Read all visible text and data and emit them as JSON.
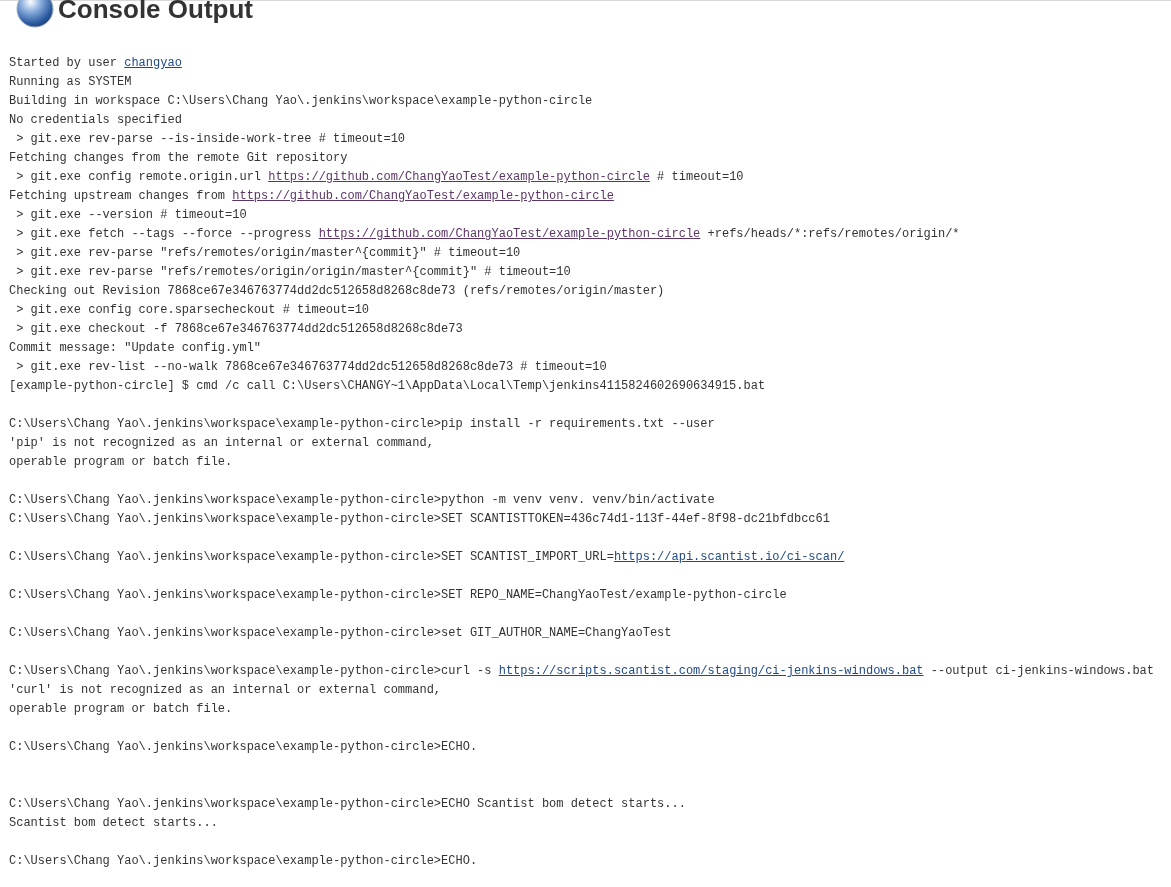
{
  "header": {
    "title": "Console Output"
  },
  "lines": [
    {
      "kind": "text",
      "segments": [
        {
          "kind": "text",
          "text": "Started by user "
        },
        {
          "kind": "link",
          "text": "changyao",
          "visited": false
        }
      ]
    },
    {
      "kind": "text",
      "segments": [
        {
          "kind": "text",
          "text": "Running as SYSTEM"
        }
      ]
    },
    {
      "kind": "text",
      "segments": [
        {
          "kind": "text",
          "text": "Building in workspace C:\\Users\\Chang Yao\\.jenkins\\workspace\\example-python-circle"
        }
      ]
    },
    {
      "kind": "text",
      "segments": [
        {
          "kind": "text",
          "text": "No credentials specified"
        }
      ]
    },
    {
      "kind": "text",
      "segments": [
        {
          "kind": "text",
          "text": " > git.exe rev-parse --is-inside-work-tree # timeout=10"
        }
      ]
    },
    {
      "kind": "text",
      "segments": [
        {
          "kind": "text",
          "text": "Fetching changes from the remote Git repository"
        }
      ]
    },
    {
      "kind": "text",
      "segments": [
        {
          "kind": "text",
          "text": " > git.exe config remote.origin.url "
        },
        {
          "kind": "link",
          "text": "https://github.com/ChangYaoTest/example-python-circle",
          "visited": true
        },
        {
          "kind": "text",
          "text": " # timeout=10"
        }
      ]
    },
    {
      "kind": "text",
      "segments": [
        {
          "kind": "text",
          "text": "Fetching upstream changes from "
        },
        {
          "kind": "link",
          "text": "https://github.com/ChangYaoTest/example-python-circle",
          "visited": true
        }
      ]
    },
    {
      "kind": "text",
      "segments": [
        {
          "kind": "text",
          "text": " > git.exe --version # timeout=10"
        }
      ]
    },
    {
      "kind": "text",
      "segments": [
        {
          "kind": "text",
          "text": " > git.exe fetch --tags --force --progress "
        },
        {
          "kind": "link",
          "text": "https://github.com/ChangYaoTest/example-python-circle",
          "visited": true
        },
        {
          "kind": "text",
          "text": " +refs/heads/*:refs/remotes/origin/*"
        }
      ]
    },
    {
      "kind": "text",
      "segments": [
        {
          "kind": "text",
          "text": " > git.exe rev-parse \"refs/remotes/origin/master^{commit}\" # timeout=10"
        }
      ]
    },
    {
      "kind": "text",
      "segments": [
        {
          "kind": "text",
          "text": " > git.exe rev-parse \"refs/remotes/origin/origin/master^{commit}\" # timeout=10"
        }
      ]
    },
    {
      "kind": "text",
      "segments": [
        {
          "kind": "text",
          "text": "Checking out Revision 7868ce67e346763774dd2dc512658d8268c8de73 (refs/remotes/origin/master)"
        }
      ]
    },
    {
      "kind": "text",
      "segments": [
        {
          "kind": "text",
          "text": " > git.exe config core.sparsecheckout # timeout=10"
        }
      ]
    },
    {
      "kind": "text",
      "segments": [
        {
          "kind": "text",
          "text": " > git.exe checkout -f 7868ce67e346763774dd2dc512658d8268c8de73"
        }
      ]
    },
    {
      "kind": "text",
      "segments": [
        {
          "kind": "text",
          "text": "Commit message: \"Update config.yml\""
        }
      ]
    },
    {
      "kind": "text",
      "segments": [
        {
          "kind": "text",
          "text": " > git.exe rev-list --no-walk 7868ce67e346763774dd2dc512658d8268c8de73 # timeout=10"
        }
      ]
    },
    {
      "kind": "text",
      "segments": [
        {
          "kind": "text",
          "text": "[example-python-circle] $ cmd /c call C:\\Users\\CHANGY~1\\AppData\\Local\\Temp\\jenkins4115824602690634915.bat"
        }
      ]
    },
    {
      "kind": "blank"
    },
    {
      "kind": "text",
      "segments": [
        {
          "kind": "text",
          "text": "C:\\Users\\Chang Yao\\.jenkins\\workspace\\example-python-circle>pip install -r requirements.txt --user"
        }
      ]
    },
    {
      "kind": "text",
      "segments": [
        {
          "kind": "text",
          "text": "'pip' is not recognized as an internal or external command,"
        }
      ]
    },
    {
      "kind": "text",
      "segments": [
        {
          "kind": "text",
          "text": "operable program or batch file."
        }
      ]
    },
    {
      "kind": "blank"
    },
    {
      "kind": "text",
      "segments": [
        {
          "kind": "text",
          "text": "C:\\Users\\Chang Yao\\.jenkins\\workspace\\example-python-circle>python -m venv venv. venv/bin/activate"
        }
      ]
    },
    {
      "kind": "text",
      "segments": [
        {
          "kind": "text",
          "text": "C:\\Users\\Chang Yao\\.jenkins\\workspace\\example-python-circle>SET SCANTISTTOKEN=436c74d1-113f-44ef-8f98-dc21bfdbcc61"
        }
      ]
    },
    {
      "kind": "blank"
    },
    {
      "kind": "text",
      "segments": [
        {
          "kind": "text",
          "text": "C:\\Users\\Chang Yao\\.jenkins\\workspace\\example-python-circle>SET SCANTIST_IMPORT_URL="
        },
        {
          "kind": "link",
          "text": "https://api.scantist.io/ci-scan/",
          "visited": false
        }
      ]
    },
    {
      "kind": "blank"
    },
    {
      "kind": "text",
      "segments": [
        {
          "kind": "text",
          "text": "C:\\Users\\Chang Yao\\.jenkins\\workspace\\example-python-circle>SET REPO_NAME=ChangYaoTest/example-python-circle"
        }
      ]
    },
    {
      "kind": "blank"
    },
    {
      "kind": "text",
      "segments": [
        {
          "kind": "text",
          "text": "C:\\Users\\Chang Yao\\.jenkins\\workspace\\example-python-circle>set GIT_AUTHOR_NAME=ChangYaoTest"
        }
      ]
    },
    {
      "kind": "blank"
    },
    {
      "kind": "text",
      "segments": [
        {
          "kind": "text",
          "text": "C:\\Users\\Chang Yao\\.jenkins\\workspace\\example-python-circle>curl -s "
        },
        {
          "kind": "link",
          "text": "https://scripts.scantist.com/staging/ci-jenkins-windows.bat",
          "visited": false
        },
        {
          "kind": "text",
          "text": " --output ci-jenkins-windows.bat"
        }
      ]
    },
    {
      "kind": "text",
      "segments": [
        {
          "kind": "text",
          "text": "'curl' is not recognized as an internal or external command,"
        }
      ]
    },
    {
      "kind": "text",
      "segments": [
        {
          "kind": "text",
          "text": "operable program or batch file."
        }
      ]
    },
    {
      "kind": "blank"
    },
    {
      "kind": "text",
      "segments": [
        {
          "kind": "text",
          "text": "C:\\Users\\Chang Yao\\.jenkins\\workspace\\example-python-circle>ECHO."
        }
      ]
    },
    {
      "kind": "blank"
    },
    {
      "kind": "blank"
    },
    {
      "kind": "text",
      "segments": [
        {
          "kind": "text",
          "text": "C:\\Users\\Chang Yao\\.jenkins\\workspace\\example-python-circle>ECHO Scantist bom detect starts..."
        }
      ]
    },
    {
      "kind": "text",
      "segments": [
        {
          "kind": "text",
          "text": "Scantist bom detect starts..."
        }
      ]
    },
    {
      "kind": "blank"
    },
    {
      "kind": "text",
      "segments": [
        {
          "kind": "text",
          "text": "C:\\Users\\Chang Yao\\.jenkins\\workspace\\example-python-circle>ECHO."
        }
      ]
    }
  ]
}
